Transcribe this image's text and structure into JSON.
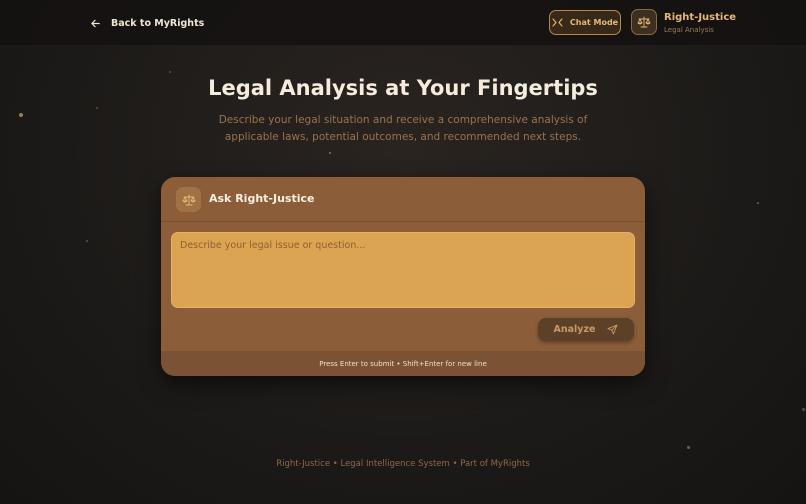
{
  "topbar": {
    "back_label": "Back to MyRights",
    "chat_mode_label": "Chat Mode",
    "brand_name": "Right-Justice",
    "brand_subtitle": "Legal Analysis"
  },
  "hero": {
    "title": "Legal Analysis at Your Fingertips",
    "description": "Describe your legal situation and receive a comprehensive analysis of applicable laws, potential outcomes, and recommended next steps."
  },
  "card": {
    "title": "Ask Right-Justice",
    "input_value": "",
    "input_placeholder": "Describe your legal issue or question...",
    "analyze_label": "Analyze",
    "hint": "Press Enter to submit • Shift+Enter for new line"
  },
  "footer": {
    "text": "Right-Justice • Legal Intelligence System • Part of MyRights"
  },
  "icons": {
    "back": "arrow-left-icon",
    "chat_mode": "chat-mode-icon",
    "brand": "scales-icon",
    "card": "scales-icon",
    "analyze": "send-icon"
  },
  "colors": {
    "accent": "#e6b877",
    "card_bg": "#8b5e39",
    "input_bg": "#dba452",
    "button_bg": "#5c4028",
    "page_bg": "#1c1a18"
  }
}
